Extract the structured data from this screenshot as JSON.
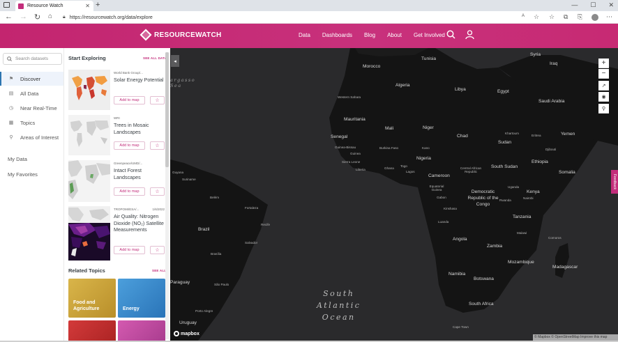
{
  "browser": {
    "tab_title": "Resource Watch",
    "url": "https://resourcewatch.org/data/explore"
  },
  "header": {
    "logo_text": "RESOURCEWATCH",
    "nav": [
      "Data",
      "Dashboards",
      "Blog",
      "About",
      "Get Involved"
    ]
  },
  "sidebar": {
    "search_placeholder": "Search datasets",
    "items": [
      {
        "label": "Discover",
        "icon": "flag-icon",
        "active": true
      },
      {
        "label": "All Data",
        "icon": "grid-icon"
      },
      {
        "label": "Near Real-Time",
        "icon": "clock-icon"
      },
      {
        "label": "Topics",
        "icon": "topics-icon"
      },
      {
        "label": "Areas of Interest",
        "icon": "pin-icon"
      }
    ],
    "links": [
      "My Data",
      "My Favorites"
    ]
  },
  "panel": {
    "start_exploring": "Start Exploring",
    "see_all_data": "SEE ALL DATA",
    "related_topics": "Related Topics",
    "see_all": "SEE ALL",
    "add_to_map": "Add to map",
    "datasets": [
      {
        "source": "World Bank Group/...",
        "title": "Solar Energy Potential",
        "date": ""
      },
      {
        "source": "WRI",
        "title": "Trees in Mosaic Landscapes",
        "date": ""
      },
      {
        "source": "Greenpeace/UMD/...",
        "title": "Intact Forest Landscapes",
        "date": ""
      },
      {
        "source": "TROPOMI/ESA/...",
        "title": "Air Quality: Nitrogen Dioxide (NO₂) Satellite Measurements",
        "date": "1/6/2022"
      }
    ],
    "topics": [
      {
        "label": "Food and Agriculture",
        "color": "#c9a43a"
      },
      {
        "label": "Energy",
        "color": "#3a8ccc"
      }
    ]
  },
  "map": {
    "ocean_label": "South Atlantic Ocean",
    "sea_label": "Sargasso Sea",
    "countries": [
      "Tunisia",
      "Syria",
      "Iraq",
      "Morocco",
      "Algeria",
      "Libya",
      "Egypt",
      "Saudi Arabia",
      "Mauritania",
      "Mali",
      "Niger",
      "Chad",
      "Sudan",
      "Yemen",
      "Senegal",
      "Nigeria",
      "Ethiopia",
      "Cameroon",
      "South Sudan",
      "Somalia",
      "Democratic Republic of the Congo",
      "Kenya",
      "Tanzania",
      "Brazil",
      "Angola",
      "Zambia",
      "Mozambique",
      "Madagascar",
      "Namibia",
      "Botswana",
      "Paraguay",
      "South Africa",
      "Uruguay"
    ],
    "small_labels": [
      "Western Sahara",
      "Guinea-Bissau",
      "Guinea",
      "Sierra Leone",
      "Liberia",
      "Burkina Faso",
      "Ghana",
      "Togo",
      "Lagos",
      "Kano",
      "Central African Republic",
      "Equatorial Guinea",
      "Gabon",
      "Eritrea",
      "Djibouti",
      "Khartoum",
      "Uganda",
      "Rwanda",
      "Nairobi",
      "Kinshasa",
      "Malawi",
      "Recife",
      "Fortaleza",
      "Belém",
      "Salvador",
      "Brasília",
      "São Paulo",
      "Porto Alegre",
      "Cape Town",
      "Guyana",
      "Suriname",
      "Comoros",
      "Luanda"
    ],
    "attribution": "© Mapbox © OpenStreetMap Improve this map",
    "mapbox": "mapbox",
    "feedback": "Feedback"
  }
}
